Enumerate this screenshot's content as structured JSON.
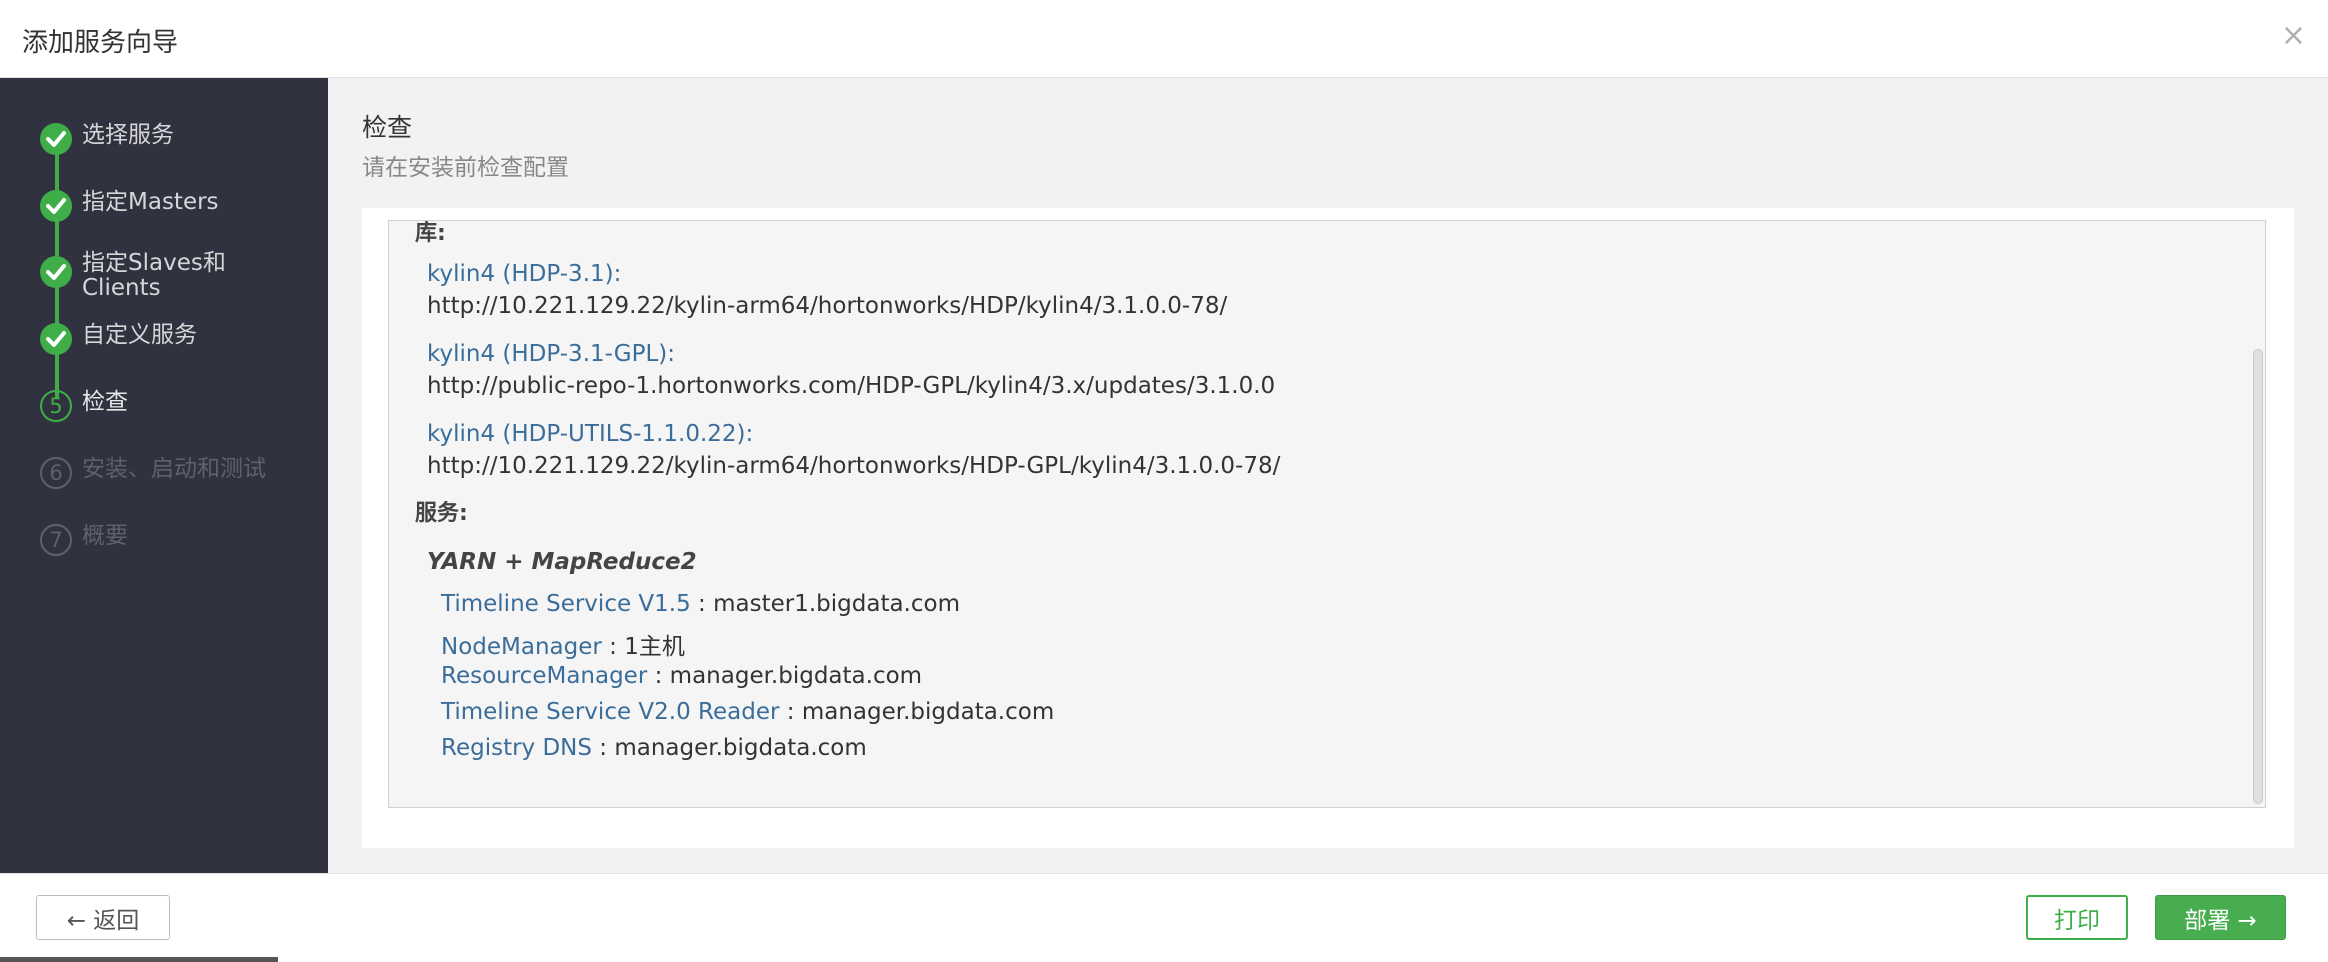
{
  "window": {
    "title": "添加服务向导",
    "close_glyph": "×"
  },
  "sidebar": {
    "steps": [
      {
        "label": "选择服务",
        "state": "done"
      },
      {
        "label": "指定Masters",
        "state": "done"
      },
      {
        "label": "指定Slaves和\nClients",
        "state": "done"
      },
      {
        "label": "自定义服务",
        "state": "done"
      },
      {
        "label": "检查",
        "state": "current",
        "number": "5"
      },
      {
        "label": "安装、启动和测试",
        "state": "todo",
        "number": "6"
      },
      {
        "label": "概要",
        "state": "todo",
        "number": "7"
      }
    ]
  },
  "main": {
    "title": "检查",
    "subtitle": "请在安装前检查配置",
    "repos_heading": "库:",
    "repos": [
      {
        "name": "kylin4 (HDP-3.1):",
        "url": "http://10.221.129.22/kylin-arm64/hortonworks/HDP/kylin4/3.1.0.0-78/"
      },
      {
        "name": "kylin4 (HDP-3.1-GPL):",
        "url": "http://public-repo-1.hortonworks.com/HDP-GPL/kylin4/3.x/updates/3.1.0.0"
      },
      {
        "name": "kylin4 (HDP-UTILS-1.1.0.22):",
        "url": "http://10.221.129.22/kylin-arm64/hortonworks/HDP-GPL/kylin4/3.1.0.0-78/"
      }
    ],
    "services_heading": "服务:",
    "service_name": "YARN + MapReduce2",
    "components": [
      {
        "name": "Timeline Service V1.5",
        "sep": " : ",
        "value": "master1.bigdata.com"
      },
      {
        "name": "NodeManager",
        "sep": " : ",
        "value": "1主机"
      },
      {
        "name": "ResourceManager",
        "sep": " : ",
        "value": "manager.bigdata.com"
      },
      {
        "name": "Timeline Service V2.0 Reader",
        "sep": " : ",
        "value": "manager.bigdata.com"
      },
      {
        "name": "Registry DNS",
        "sep": " : ",
        "value": "manager.bigdata.com"
      }
    ]
  },
  "footer": {
    "back_label": "← 返回",
    "print_label": "打印",
    "deploy_label": "部署 →"
  },
  "colors": {
    "sidebar_bg": "#313240",
    "accent_green": "#3fae49",
    "link_blue": "#3a6d99",
    "content_bg": "#f2f2f2"
  },
  "icons": {
    "done_step": "check-icon",
    "close": "close-icon"
  }
}
